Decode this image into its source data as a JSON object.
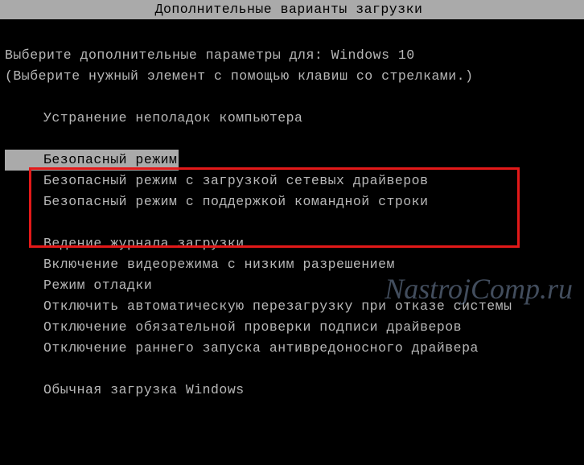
{
  "title": "Дополнительные варианты загрузки",
  "prompt_prefix": "Выберите дополнительные параметры для: ",
  "os_name": "Windows 10",
  "hint": "(Выберите нужный элемент с помощью клавиш со стрелками.)",
  "menu": {
    "repair": "Устранение неполадок компьютера",
    "safe_mode": "Безопасный режим",
    "safe_mode_net": "Безопасный режим с загрузкой сетевых драйверов",
    "safe_mode_cmd": "Безопасный режим с поддержкой командной строки",
    "boot_log": "Ведение журнала загрузки",
    "low_res": "Включение видеорежима с низким разрешением",
    "debug": "Режим отладки",
    "no_auto_restart": "Отключить автоматическую перезагрузку при отказе системы",
    "no_sig_enforce": "Отключение обязательной проверки подписи драйверов",
    "no_elam": "Отключение раннего запуска антивредоносного драйвера",
    "normal": "Обычная загрузка Windows"
  },
  "watermark": "NastrojComp.ru",
  "colors": {
    "bg": "#000000",
    "fg": "#b8b8b8",
    "highlight_bg": "#aaaaaa",
    "highlight_fg": "#000000",
    "box": "#e31919"
  }
}
